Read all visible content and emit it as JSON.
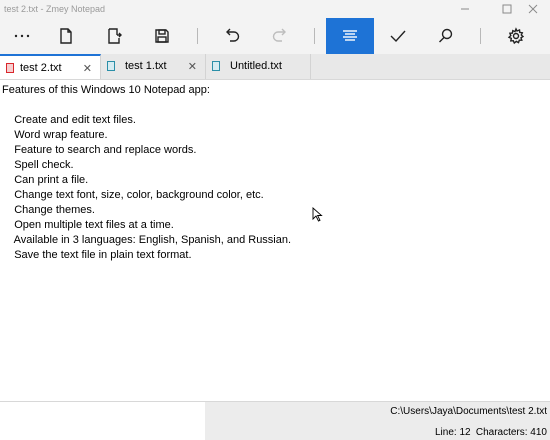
{
  "window": {
    "title": "test 2.txt - Zmey Notepad"
  },
  "toolbar": {
    "items": [
      {
        "icon": "more-icon"
      },
      {
        "icon": "new-file-icon"
      },
      {
        "icon": "open-file-icon"
      },
      {
        "icon": "save-icon"
      },
      {
        "icon": "undo-icon"
      },
      {
        "icon": "redo-icon",
        "disabled": true
      },
      {
        "icon": "word-wrap-icon",
        "active": true
      },
      {
        "icon": "spell-check-icon"
      },
      {
        "icon": "search-icon"
      },
      {
        "icon": "settings-icon"
      }
    ],
    "accent": "#1e73d6"
  },
  "tabs": [
    {
      "label": "test 2.txt",
      "active": true,
      "icon_color": "#d9262c"
    },
    {
      "label": "test 1.txt",
      "active": false,
      "icon_color": "#2b8fa8"
    },
    {
      "label": "Untitled.txt",
      "active": false,
      "icon_color": "#2b8fa8"
    }
  ],
  "tab_close_glyph": "✕",
  "editor": {
    "lines": [
      "Features of this Windows 10 Notepad app:",
      "",
      "    Create and edit text files.",
      "    Word wrap feature.",
      "    Feature to search and replace words.",
      "    Spell check.",
      "    Can print a file.",
      "    Change text font, size, color, background color, etc.",
      "    Change themes.",
      "    Open multiple text files at a time.",
      "    Available in 3 languages: English, Spanish, and Russian.",
      "    Save the text file in plain text format."
    ]
  },
  "status": {
    "path": "C:\\Users\\Jaya\\Documents\\test 2.txt",
    "line": "Line: 12",
    "characters": "Characters: 410"
  }
}
